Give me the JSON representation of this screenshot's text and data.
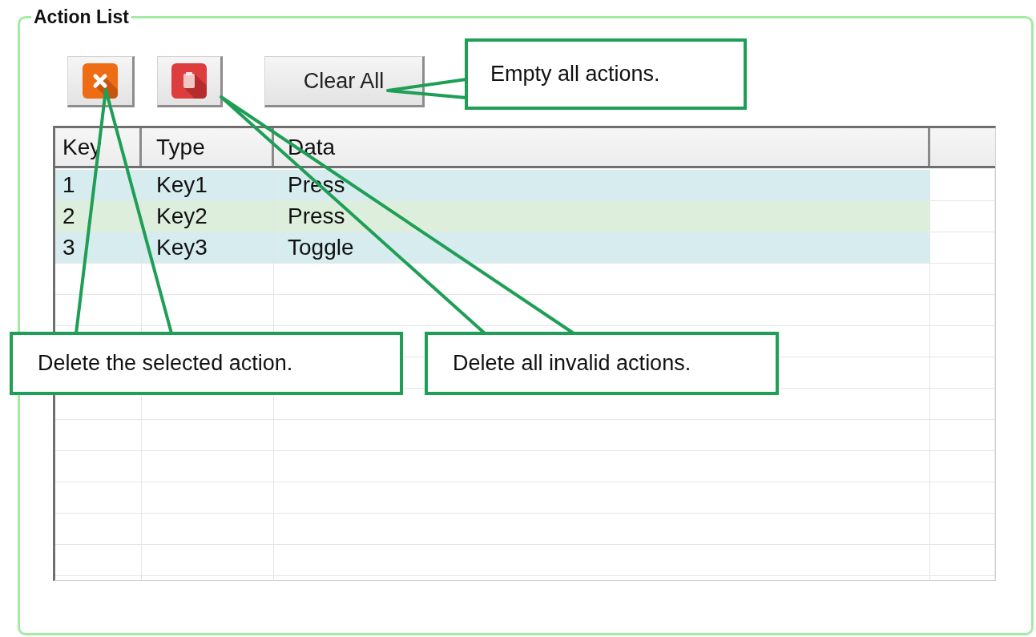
{
  "group": {
    "title": "Action List"
  },
  "toolbar": [
    {
      "kind": "remove"
    },
    {
      "kind": "purge"
    },
    {
      "kind": "text",
      "label": "Clear All"
    }
  ],
  "table": {
    "columns": [
      "Key",
      "Type",
      "Data"
    ],
    "rows": [
      {
        "key": "1",
        "type": "Key1",
        "data": "Press",
        "color": "#d6ecef"
      },
      {
        "key": "2",
        "type": "Key2",
        "data": "Press",
        "color": "#ddefdc"
      },
      {
        "key": "3",
        "type": "Key3",
        "data": "Toggle",
        "color": "#d6ecef"
      }
    ]
  },
  "callouts": [
    {
      "text": "Empty all actions."
    },
    {
      "text": "Delete the selected action."
    },
    {
      "text": "Delete all invalid actions."
    }
  ]
}
